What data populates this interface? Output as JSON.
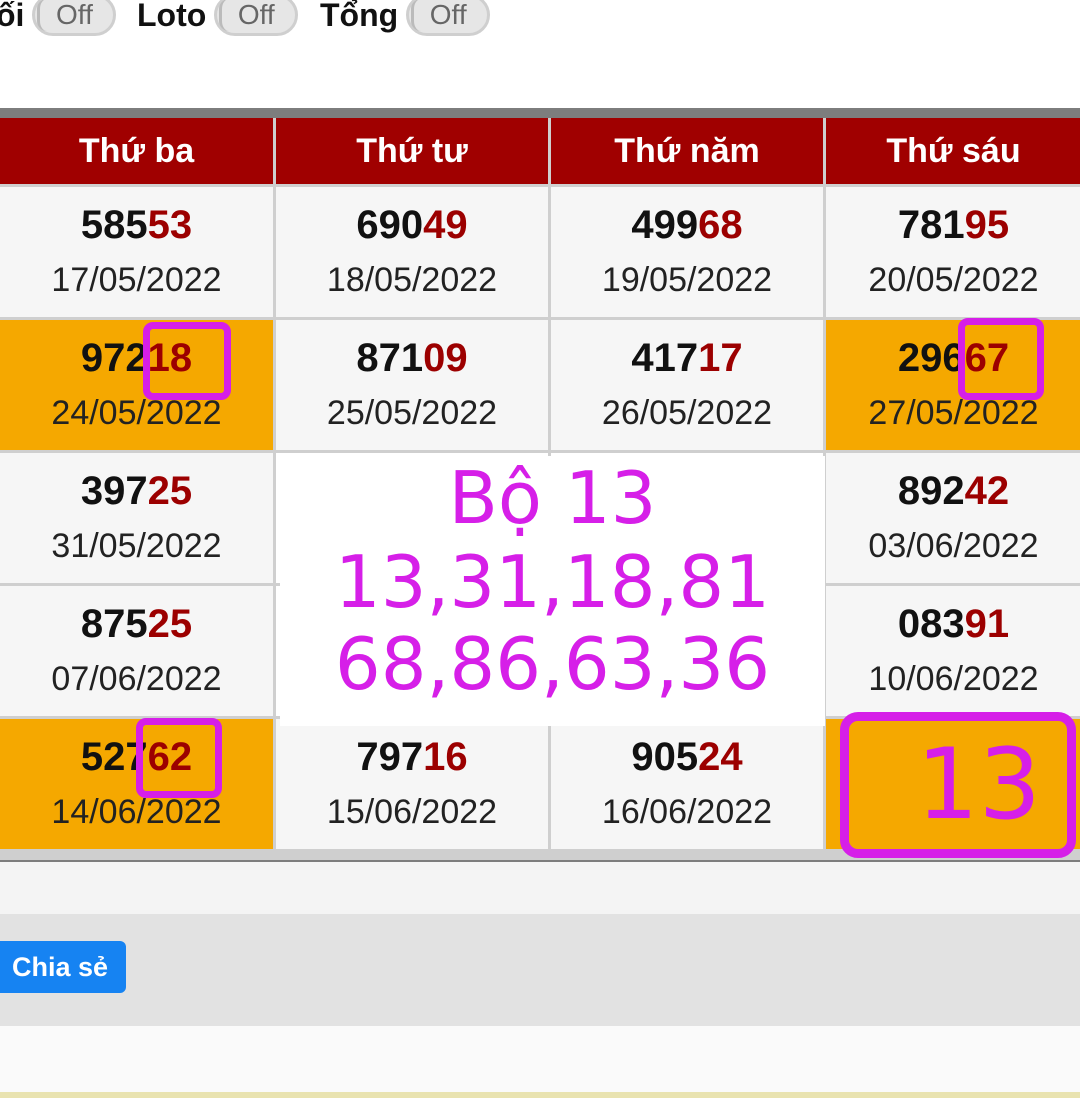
{
  "toggles": [
    {
      "label": "ối",
      "state": "Off"
    },
    {
      "label": "Loto",
      "state": "Off"
    },
    {
      "label": "Tổng",
      "state": "Off"
    }
  ],
  "table": {
    "headers": [
      "Thứ ba",
      "Thứ tư",
      "Thứ năm",
      "Thứ sáu"
    ],
    "rows": [
      [
        {
          "head": "585",
          "tail": "53",
          "date": "17/05/2022",
          "highlight": false
        },
        {
          "head": "690",
          "tail": "49",
          "date": "18/05/2022",
          "highlight": false
        },
        {
          "head": "499",
          "tail": "68",
          "date": "19/05/2022",
          "highlight": false
        },
        {
          "head": "781",
          "tail": "95",
          "date": "20/05/2022",
          "highlight": false
        }
      ],
      [
        {
          "head": "972",
          "tail": "18",
          "date": "24/05/2022",
          "highlight": true
        },
        {
          "head": "871",
          "tail": "09",
          "date": "25/05/2022",
          "highlight": false
        },
        {
          "head": "417",
          "tail": "17",
          "date": "26/05/2022",
          "highlight": false
        },
        {
          "head": "296",
          "tail": "67",
          "date": "27/05/2022",
          "highlight": true
        }
      ],
      [
        {
          "head": "397",
          "tail": "25",
          "date": "31/05/2022",
          "highlight": false
        },
        null,
        null,
        {
          "head": "892",
          "tail": "42",
          "date": "03/06/2022",
          "highlight": false
        }
      ],
      [
        {
          "head": "875",
          "tail": "25",
          "date": "07/06/2022",
          "highlight": false
        },
        null,
        null,
        {
          "head": "083",
          "tail": "91",
          "date": "10/06/2022",
          "highlight": false
        }
      ],
      [
        {
          "head": "527",
          "tail": "62",
          "date": "14/06/2022",
          "highlight": true
        },
        {
          "head": "797",
          "tail": "16",
          "date": "15/06/2022",
          "highlight": false
        },
        {
          "head": "905",
          "tail": "24",
          "date": "16/06/2022",
          "highlight": false
        },
        {
          "head": "",
          "tail": "",
          "date": "",
          "highlight": true
        }
      ]
    ]
  },
  "annotation": {
    "lines": [
      "Bộ 13",
      "13,31,18,81",
      "68,86,63,36"
    ],
    "big_number": "13",
    "color": "#d61fe8"
  },
  "share": {
    "label": "Chia sẻ"
  },
  "colors": {
    "header_bg": "#a00000",
    "highlight": "#f5a800",
    "tail": "#9c0000",
    "button": "#1683f2"
  }
}
